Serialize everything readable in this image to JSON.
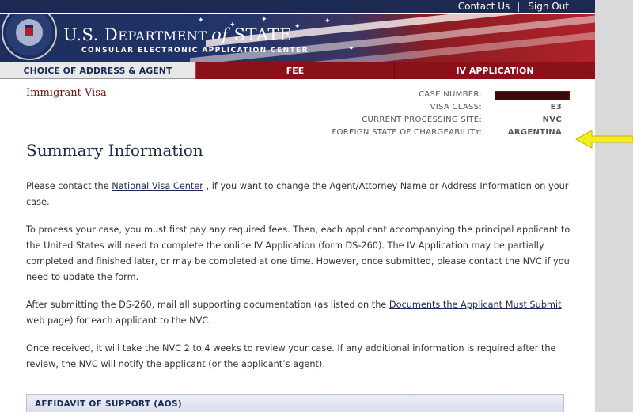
{
  "header": {
    "nav_links": [
      "Contact Us",
      "Sign Out"
    ],
    "dept_prefix": "U.S. D",
    "dept_mid": "EPARTMENT ",
    "dept_of": "of",
    "dept_state": " STATE",
    "subtitle": "CONSULAR ELECTRONIC APPLICATION CENTER"
  },
  "tabs": [
    {
      "label": "CHOICE OF ADDRESS & AGENT",
      "active": true
    },
    {
      "label": "FEE",
      "active": false
    },
    {
      "label": "IV APPLICATION",
      "active": false
    }
  ],
  "visa_title": "Immigrant Visa",
  "case_info": [
    {
      "label": "CASE NUMBER:",
      "value": "",
      "redacted": true
    },
    {
      "label": "VISA CLASS:",
      "value": "E3"
    },
    {
      "label": "CURRENT PROCESSING SITE:",
      "value": "NVC"
    },
    {
      "label": "FOREIGN STATE OF CHARGEABILITY:",
      "value": "ARGENTINA"
    }
  ],
  "summary_heading": "Summary Information",
  "paragraphs": {
    "p1_before": "Please contact the ",
    "p1_link": "National Visa Center",
    "p1_after": " , if you want to change the Agent/Attorney Name or Address Information on your case.",
    "p2": "To process your case, you must first pay any required fees. Then, each applicant accompanying the principal applicant to the United States will need to complete the online IV Application (form DS-260). The IV Application may be partially completed and finished later, or may be completed at one time. However, once submitted, please contact the NVC if you need to update the form.",
    "p3_before": "After submitting the DS-260, mail all supporting documentation (as listed on the ",
    "p3_link": "Documents the Applicant Must Submit",
    "p3_after": " web page) for each applicant to the NVC.",
    "p4": "Once received, it will take the NVC 2 to 4 weeks to review your case. If any additional information is required after the review, the NVC will notify the applicant (or the applicant’s agent)."
  },
  "aos_section": "AFFIDAVIT OF SUPPORT (AOS)",
  "colors": {
    "navy": "#1c2a52",
    "tab_red": "#8c1018",
    "title_red": "#7a1111",
    "arrow_yellow": "#f4ee1c"
  },
  "icons": {
    "seal": "department-of-state-seal",
    "annotation": "yellow-arrow-left"
  }
}
